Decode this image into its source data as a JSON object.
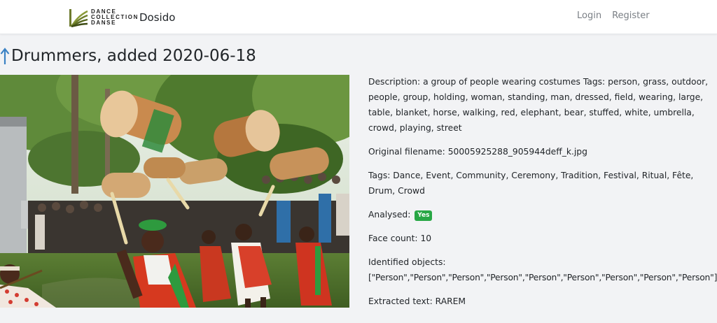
{
  "brand": {
    "wordmark_lines": [
      "DANCE",
      "COLLECTION",
      "DANSE"
    ],
    "name": "Dosido"
  },
  "nav": {
    "login": "Login",
    "register": "Register"
  },
  "page": {
    "title": "Drummers, added 2020-06-18"
  },
  "details": {
    "description_label": "Description:",
    "description": "a group of people wearing costumes Tags: person, grass, outdoor, people, group, holding, woman, standing, man, dressed, field, wearing, large, table, blanket, horse, walking, red, elephant, bear, stuffed, white, umbrella, crowd, playing, street",
    "filename_label": "Original filename:",
    "filename": "50005925288_905944deff_k.jpg",
    "tags_label": "Tags:",
    "tags": "Dance, Event, Community, Ceremony, Tradition, Festival, Ritual, Fête, Drum, Crowd",
    "analysed_label": "Analysed:",
    "analysed_badge": "Yes",
    "face_count_label": "Face count:",
    "face_count": "10",
    "objects_label": "Identified objects:",
    "objects": "[\"Person\",\"Person\",\"Person\",\"Person\",\"Person\",\"Person\",\"Person\",\"Person\",\"Person\"]",
    "extracted_label": "Extracted text:",
    "extracted_text": "RAREM"
  },
  "colors": {
    "accent_blue": "#3b82c4",
    "badge_green": "#28a745",
    "nav_text": "#7a7f85",
    "page_bg": "#f2f3f5"
  },
  "icons": {
    "back": "up-arrow-icon",
    "logo": "dance-collection-logo-icon"
  }
}
